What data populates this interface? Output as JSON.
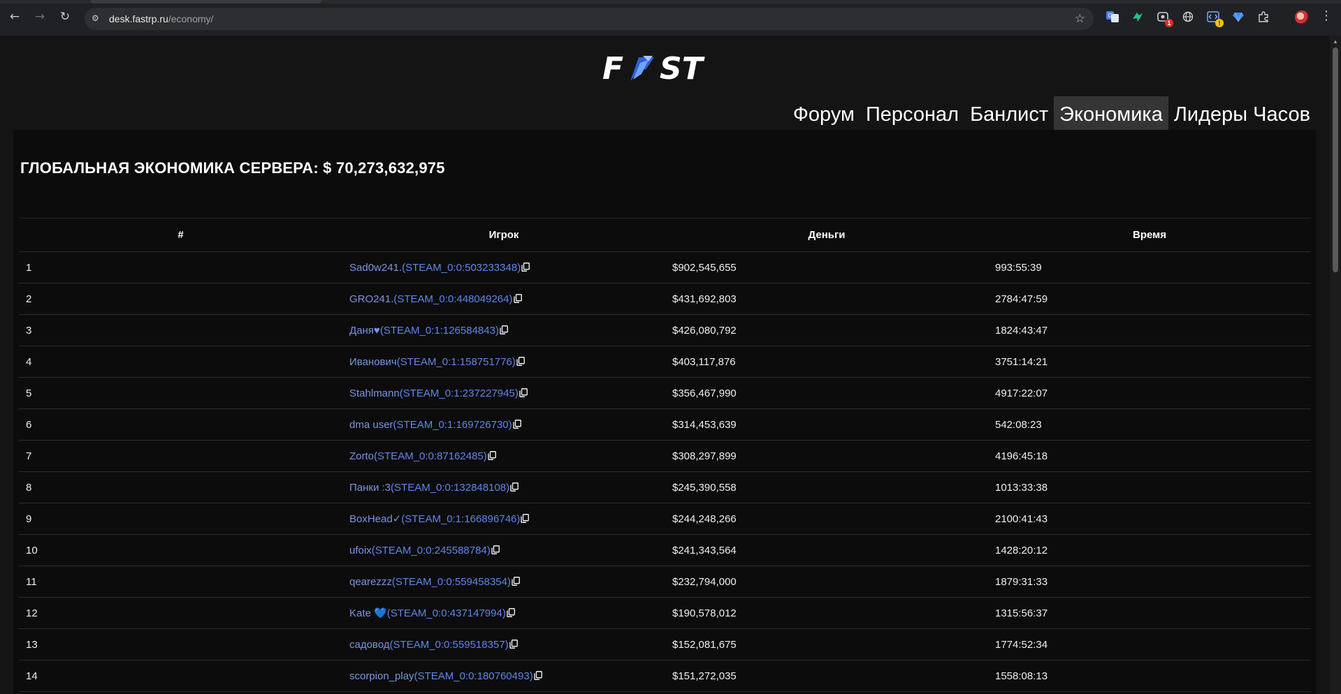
{
  "browser": {
    "url_host": "desk.fastrp.ru",
    "url_path": "/economy/",
    "extension_badges": {
      "first": "1",
      "second": "!"
    }
  },
  "logo_text": "FAST",
  "nav": [
    {
      "label": "Форум"
    },
    {
      "label": "Персонал"
    },
    {
      "label": "Банлист"
    },
    {
      "label": "Экономика",
      "active": true
    },
    {
      "label": "Лидеры Часов"
    }
  ],
  "economy": {
    "title": "ГЛОБАЛЬНАЯ ЭКОНОМИКА СЕРВЕРА: $ 70,273,632,975"
  },
  "table": {
    "columns": [
      "#",
      "Игрок",
      "Деньги",
      "Время"
    ],
    "rows": [
      {
        "rank": "1",
        "name": "Sad0w241.",
        "steam": "STEAM_0:0:503233348",
        "money": "$902,545,655",
        "time": "993:55:39"
      },
      {
        "rank": "2",
        "name": "GRO241.",
        "steam": "STEAM_0:0:448049264",
        "money": "$431,692,803",
        "time": "2784:47:59"
      },
      {
        "rank": "3",
        "name": "Даня♥",
        "steam": "STEAM_0:1:126584843",
        "money": "$426,080,792",
        "time": "1824:43:47"
      },
      {
        "rank": "4",
        "name": "Иванович",
        "steam": "STEAM_0:1:158751776",
        "money": "$403,117,876",
        "time": "3751:14:21"
      },
      {
        "rank": "5",
        "name": "Stahlmann",
        "steam": "STEAM_0:1:237227945",
        "money": "$356,467,990",
        "time": "4917:22:07"
      },
      {
        "rank": "6",
        "name": "dma user",
        "steam": "STEAM_0:1:169726730",
        "money": "$314,453,639",
        "time": "542:08:23"
      },
      {
        "rank": "7",
        "name": "Zorto",
        "steam": "STEAM_0:0:87162485",
        "money": "$308,297,899",
        "time": "4196:45:18"
      },
      {
        "rank": "8",
        "name": "Панки :3",
        "steam": "STEAM_0:0:132848108",
        "money": "$245,390,558",
        "time": "1013:33:38"
      },
      {
        "rank": "9",
        "name": "BoxHead✓",
        "steam": "STEAM_0:1:166896746",
        "money": "$244,248,266",
        "time": "2100:41:43"
      },
      {
        "rank": "10",
        "name": "ufoix",
        "steam": "STEAM_0:0:245588784",
        "money": "$241,343,564",
        "time": "1428:20:12"
      },
      {
        "rank": "11",
        "name": "qearezzz",
        "steam": "STEAM_0:0:559458354",
        "money": "$232,794,000",
        "time": "1879:31:33"
      },
      {
        "rank": "12",
        "name": "Kate 💙",
        "steam": "STEAM_0:0:437147994",
        "money": "$190,578,012",
        "time": "1315:56:37"
      },
      {
        "rank": "13",
        "name": "садовод",
        "steam": "STEAM_0:0:559518357",
        "money": "$152,081,675",
        "time": "1774:52:34"
      },
      {
        "rank": "14",
        "name": "scorpion_play",
        "steam": "STEAM_0:0:180760493",
        "money": "$151,272,035",
        "time": "1558:08:13"
      }
    ]
  }
}
